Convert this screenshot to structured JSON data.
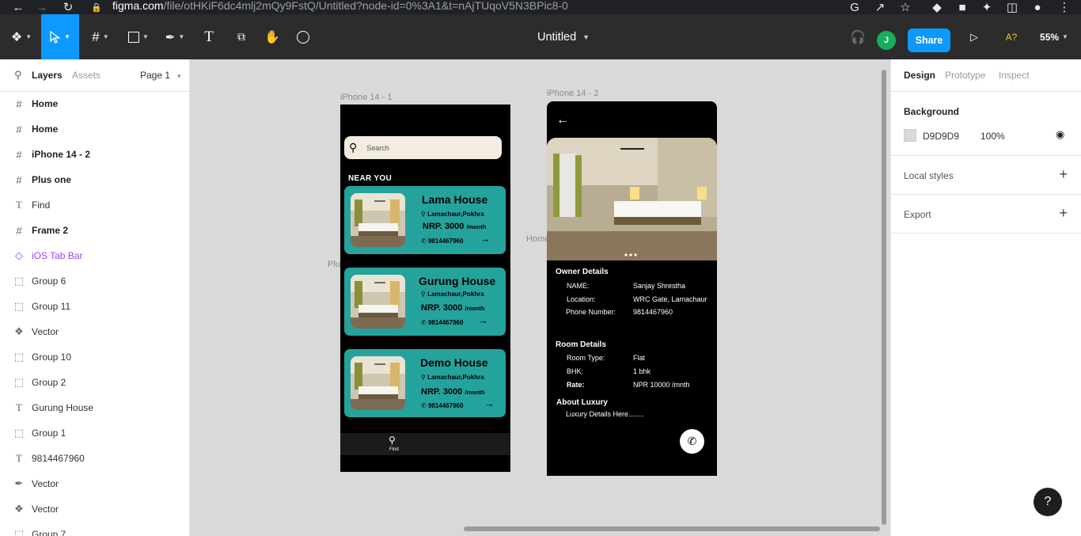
{
  "browser": {
    "url_host": "figma.com",
    "url_path": "/file/otHKiF6dc4mlj2mQy9FstQ/Untitled?node-id=0%3A1&t=nAjTUqoV5N3BPic8-0"
  },
  "toolbar": {
    "file_title": "Untitled",
    "share_label": "Share",
    "avatar_initial": "J",
    "font_warning": "A?",
    "zoom": "55%"
  },
  "left_panel": {
    "tabs": {
      "layers": "Layers",
      "assets": "Assets",
      "page": "Page 1"
    },
    "layers": [
      {
        "type": "frame",
        "name": "Home",
        "icon": "frame-icon"
      },
      {
        "type": "frame",
        "name": "Home",
        "icon": "frame-icon"
      },
      {
        "type": "frame",
        "name": "iPhone 14 - 2",
        "icon": "frame-icon"
      },
      {
        "type": "frame",
        "name": "Plus one",
        "icon": "frame-icon"
      },
      {
        "type": "text",
        "name": "Find",
        "icon": "text-icon"
      },
      {
        "type": "frame",
        "name": "Frame 2",
        "icon": "frame-icon"
      },
      {
        "type": "component",
        "name": "iOS Tab Bar",
        "icon": "component-icon"
      },
      {
        "type": "group",
        "name": "Group 6",
        "icon": "group-icon"
      },
      {
        "type": "group",
        "name": "Group 11",
        "icon": "group-icon"
      },
      {
        "type": "vector",
        "name": "Vector",
        "icon": "vector-icon"
      },
      {
        "type": "group",
        "name": "Group 10",
        "icon": "group-icon"
      },
      {
        "type": "group",
        "name": "Group 2",
        "icon": "group-icon"
      },
      {
        "type": "text",
        "name": "Gurung House",
        "icon": "text-icon"
      },
      {
        "type": "group",
        "name": "Group 1",
        "icon": "group-icon"
      },
      {
        "type": "text",
        "name": "9814467960",
        "icon": "text-icon"
      },
      {
        "type": "vector",
        "name": "Vector",
        "icon": "vector-icon"
      },
      {
        "type": "vector",
        "name": "Vector",
        "icon": "vector-icon"
      },
      {
        "type": "group",
        "name": "Group 7",
        "icon": "group-icon"
      }
    ]
  },
  "canvas": {
    "label_phone1": "iPhone 14 - 1",
    "label_phone2": "iPhone 14 - 2",
    "label_home": "Home",
    "label_plus": "Plu",
    "phone1": {
      "search_placeholder": "Search",
      "near_you": "NEAR YOU",
      "cards": [
        {
          "name": "Lama House",
          "location": "Lamachaur,Pokhra",
          "price": "NRP. 3000",
          "per": "/month",
          "phone": "9814467960"
        },
        {
          "name": "Gurung House",
          "location": "Lamachaur,Pokhra",
          "price": "NRP. 3000",
          "per": "/month",
          "phone": "9814467960"
        },
        {
          "name": "Demo House",
          "location": "Lamachaur,Pokhra",
          "price": "NRP. 3000",
          "per": "/month",
          "phone": "9814467960"
        }
      ],
      "tab_find": "Find"
    },
    "phone2": {
      "owner_heading": "Owner Details",
      "owner_rows": [
        {
          "label": "NAME:",
          "value": "Sanjay Shrestha"
        },
        {
          "label": "Location:",
          "value": "WRC Gate, Lamachaur"
        },
        {
          "label": "Phone Number:",
          "value": "9814467960"
        }
      ],
      "room_heading": "Room Details",
      "room_rows": [
        {
          "label": "Room Type:",
          "value": "Flat"
        },
        {
          "label": "BHK:",
          "value": "1 bhk"
        },
        {
          "label": "Rate:",
          "value": "NPR 10000 /mnth"
        }
      ],
      "about_heading": "About Luxury",
      "about_text": "Luxury Details Here........"
    }
  },
  "right_panel": {
    "tabs": {
      "design": "Design",
      "prototype": "Prototype",
      "inspect": "Inspect"
    },
    "background_label": "Background",
    "bg_color": "D9D9D9",
    "bg_opacity": "100%",
    "local_styles": "Local styles",
    "export": "Export"
  },
  "colors": {
    "accent": "#0d99ff",
    "card_teal": "#24a39d",
    "canvas_bg": "#d9d9d9",
    "toolbar_bg": "#2c2c2c"
  },
  "help_label": "?"
}
